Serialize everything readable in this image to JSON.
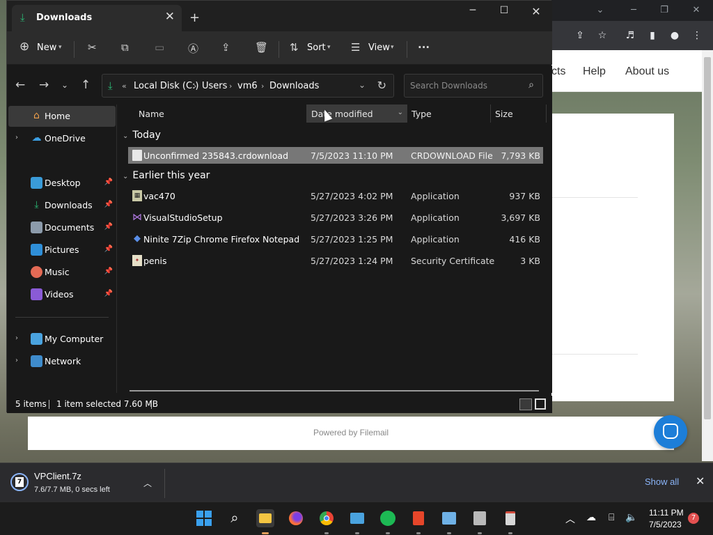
{
  "browser": {
    "nav_links": [
      "cts",
      "Help",
      "About us"
    ],
    "footer_text": "Powered by Filemail"
  },
  "explorer": {
    "tab_title": "Downloads",
    "toolbar": {
      "new_label": "New",
      "sort_label": "Sort",
      "view_label": "View",
      "more": "···"
    },
    "address": {
      "overflow": "«",
      "crumbs": [
        "Local Disk (C:)",
        "Users",
        "vm6",
        "Downloads"
      ]
    },
    "search_placeholder": "Search Downloads",
    "sidebar": {
      "home": "Home",
      "onedrive": "OneDrive",
      "desktop": "Desktop",
      "downloads": "Downloads",
      "documents": "Documents",
      "pictures": "Pictures",
      "music": "Music",
      "videos": "Videos",
      "my_computer": "My Computer",
      "network": "Network"
    },
    "columns": {
      "name": "Name",
      "date": "Date modified",
      "type": "Type",
      "size": "Size"
    },
    "groups": {
      "today": "Today",
      "earlier": "Earlier this year"
    },
    "files": [
      {
        "name": "Unconfirmed 235843.crdownload",
        "date": "7/5/2023 11:10 PM",
        "type": "CRDOWNLOAD File",
        "size": "7,793 KB"
      },
      {
        "name": "vac470",
        "date": "5/27/2023 4:02 PM",
        "type": "Application",
        "size": "937 KB"
      },
      {
        "name": "VisualStudioSetup",
        "date": "5/27/2023 3:26 PM",
        "type": "Application",
        "size": "3,697 KB"
      },
      {
        "name": "Ninite 7Zip Chrome Firefox Notepad Inst...",
        "date": "5/27/2023 1:25 PM",
        "type": "Application",
        "size": "416 KB"
      },
      {
        "name": "penis",
        "date": "5/27/2023 1:24 PM",
        "type": "Security Certificate",
        "size": "3 KB"
      }
    ],
    "status": {
      "items": "5 items",
      "selected": "1 item selected  7.60 MB"
    }
  },
  "download_bar": {
    "file_name": "VPClient.7z",
    "progress_text": "7.6/7.7 MB, 0 secs left",
    "show_all": "Show all"
  },
  "taskbar": {
    "time": "11:11 PM",
    "date": "7/5/2023",
    "notification_count": "7"
  },
  "colors": {
    "accent_green": "#2bb673",
    "selection": "#777777",
    "link_blue": "#8ab4f8"
  }
}
